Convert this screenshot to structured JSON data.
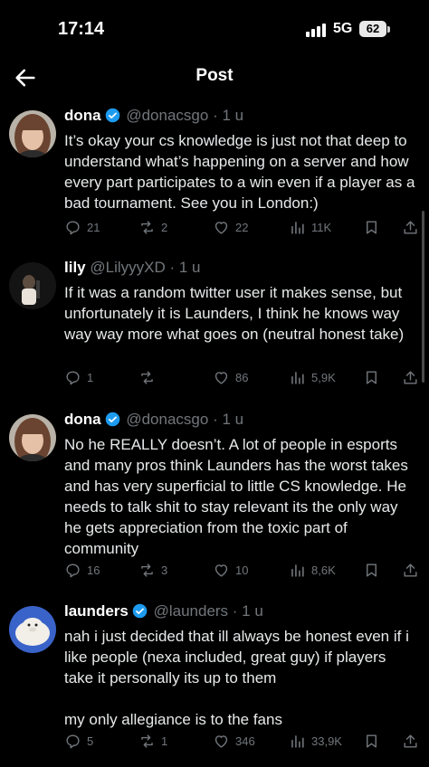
{
  "status_bar": {
    "time": "17:14",
    "network": "5G",
    "battery": "62"
  },
  "header": {
    "title": "Post"
  },
  "tweets": [
    {
      "name": "dona",
      "handle": "@donacsgo",
      "time": "· 1 u",
      "text": "It’s okay your cs knowledge is just not that deep to understand what’s happening on a server and how every part participates to a win even if a player as a bad tournament. See you in London:)",
      "replies": "21",
      "reposts": "2",
      "likes": "22",
      "views": "11K"
    },
    {
      "name": "lily",
      "handle": "@LilyyyXD",
      "time": "· 1 u",
      "text": "If it was a random twitter user it makes sense, but unfortunately it is Launders, I think he knows way way way more what goes on (neutral honest take)",
      "replies": "1",
      "reposts": "",
      "likes": "86",
      "views": "5,9K"
    },
    {
      "name": "dona",
      "handle": "@donacsgo",
      "time": "· 1 u",
      "text": "No he REALLY doesn’t. A lot of people in esports and many pros think Launders has the worst takes and has very superficial to little CS knowledge. He needs to talk shit to stay relevant its the only way he gets appreciation from the toxic part of community",
      "replies": "16",
      "reposts": "3",
      "likes": "10",
      "views": "8,6K"
    },
    {
      "name": "launders",
      "handle": "@launders",
      "time": "· 1 u",
      "text": "nah i just decided that ill always be honest even if i like people (nexa included, great guy) if players take it personally its up to them\n\nmy only allegiance is to the fans",
      "replies": "5",
      "reposts": "1",
      "likes": "346",
      "views": "33,9K"
    }
  ],
  "colors": {
    "accent_verified": "#1d9bf0",
    "muted": "#71767b",
    "background": "#000000"
  }
}
